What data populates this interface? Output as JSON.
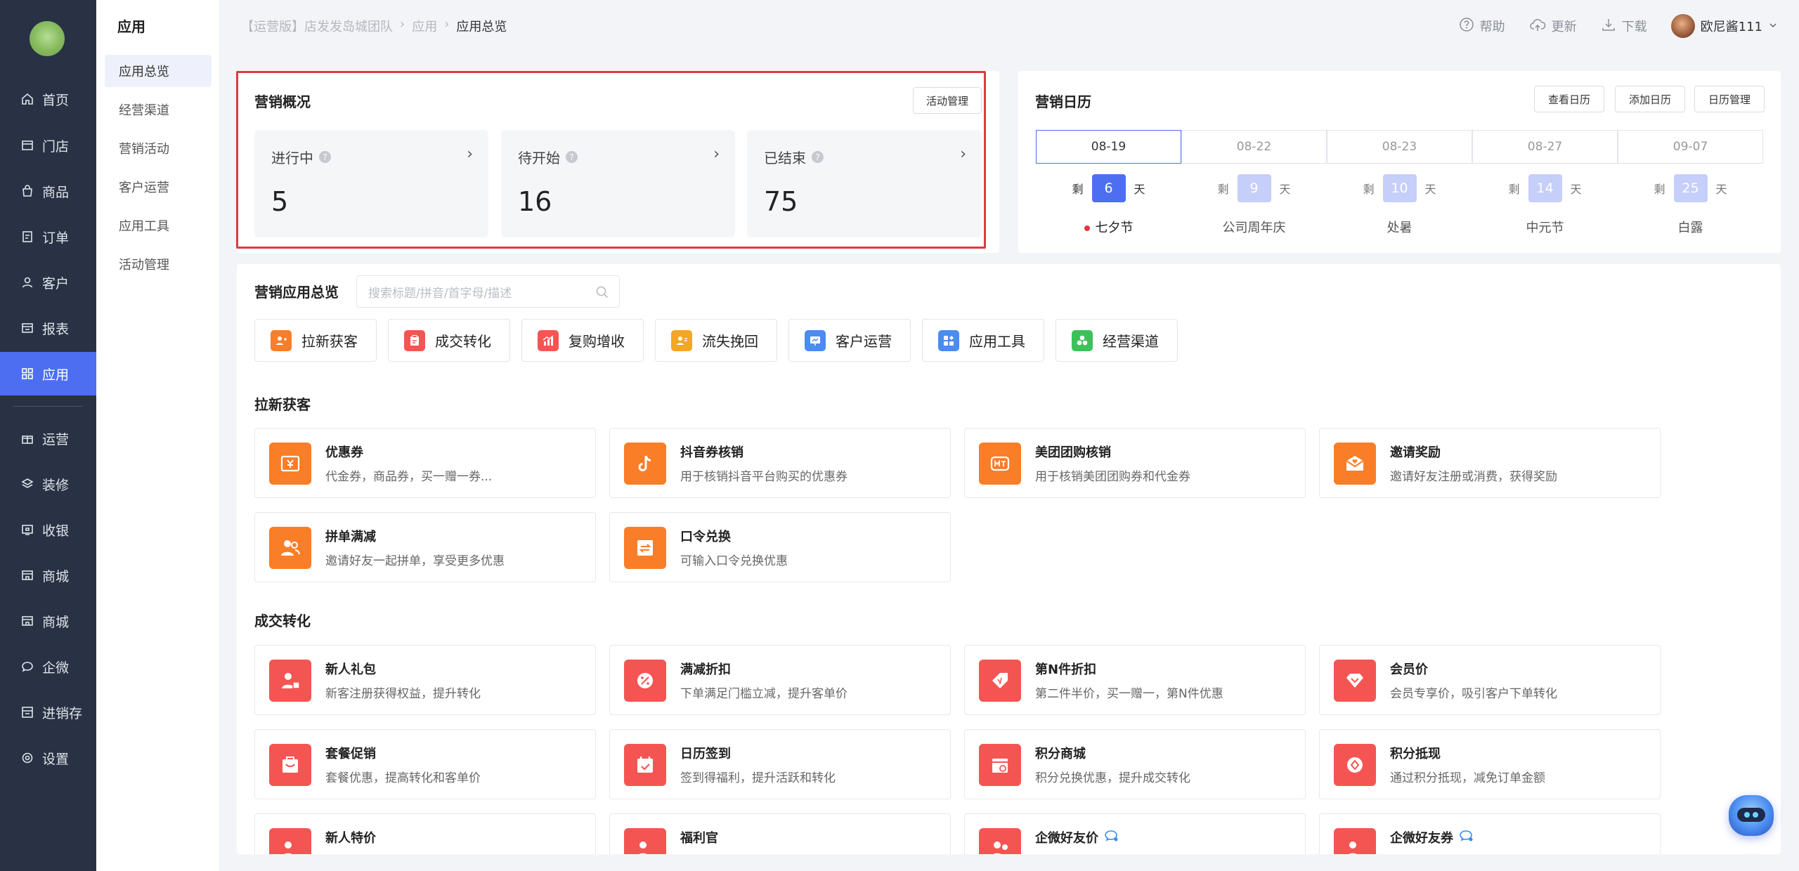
{
  "nav": {
    "items": [
      {
        "label": "首页",
        "icon": "home-icon"
      },
      {
        "label": "门店",
        "icon": "store-icon"
      },
      {
        "label": "商品",
        "icon": "bag-icon"
      },
      {
        "label": "订单",
        "icon": "order-icon"
      },
      {
        "label": "客户",
        "icon": "user-icon"
      },
      {
        "label": "报表",
        "icon": "report-icon"
      },
      {
        "label": "应用",
        "icon": "grid-icon"
      },
      {
        "label": "运营",
        "icon": "gift-icon"
      },
      {
        "label": "装修",
        "icon": "layers-icon"
      },
      {
        "label": "收银",
        "icon": "cashier-icon"
      },
      {
        "label": "商城",
        "icon": "shop-icon"
      },
      {
        "label": "商城",
        "icon": "shop-icon"
      },
      {
        "label": "企微",
        "icon": "chat-icon"
      },
      {
        "label": "进销存",
        "icon": "inventory-icon"
      },
      {
        "label": "设置",
        "icon": "gear-icon"
      }
    ],
    "active": "应用"
  },
  "subnav": {
    "title": "应用",
    "items": [
      "应用总览",
      "经营渠道",
      "营销活动",
      "客户运营",
      "应用工具",
      "活动管理"
    ]
  },
  "header": {
    "breadcrumb": [
      "【运营版】店发发岛城团队",
      "应用",
      "应用总览"
    ],
    "help": "帮助",
    "update": "更新",
    "download": "下载",
    "username": "欧尼酱111"
  },
  "overview": {
    "title": "营销概况",
    "manage_btn": "活动管理",
    "stats": [
      {
        "label": "进行中",
        "value": "5"
      },
      {
        "label": "待开始",
        "value": "16"
      },
      {
        "label": "已结束",
        "value": "75"
      }
    ]
  },
  "calendar": {
    "title": "营销日历",
    "buttons": [
      "查看日历",
      "添加日历",
      "日历管理"
    ],
    "remain_prefix": "剩",
    "remain_suffix": "天",
    "days": [
      {
        "date": "08-19",
        "remain": "6",
        "festival": "七夕节"
      },
      {
        "date": "08-22",
        "remain": "9",
        "festival": "公司周年庆"
      },
      {
        "date": "08-23",
        "remain": "10",
        "festival": "处暑"
      },
      {
        "date": "08-27",
        "remain": "14",
        "festival": "中元节"
      },
      {
        "date": "09-07",
        "remain": "25",
        "festival": "白露"
      }
    ]
  },
  "apps": {
    "title": "营销应用总览",
    "search_placeholder": "搜索标题/拼音/首字母/描述",
    "categories": [
      {
        "label": "拉新获客",
        "color": "#fa7d28"
      },
      {
        "label": "成交转化",
        "color": "#f45553"
      },
      {
        "label": "复购增收",
        "color": "#f45553"
      },
      {
        "label": "流失挽回",
        "color": "#f5a623"
      },
      {
        "label": "客户运营",
        "color": "#4a8cf0"
      },
      {
        "label": "应用工具",
        "color": "#4a8cf0"
      },
      {
        "label": "经营渠道",
        "color": "#3cc25a"
      }
    ],
    "sections": [
      {
        "title": "拉新获客",
        "items": [
          {
            "name": "优惠券",
            "desc": "代金券，商品券，买一赠一券...",
            "icon": "coupon-icon"
          },
          {
            "name": "抖音券核销",
            "desc": "用于核销抖音平台购买的优惠券",
            "icon": "douyin-icon"
          },
          {
            "name": "美团团购核销",
            "desc": "用于核销美团团购券和代金券",
            "icon": "meituan-icon"
          },
          {
            "name": "邀请奖励",
            "desc": "邀请好友注册或消费，获得奖励",
            "icon": "invite-icon"
          },
          {
            "name": "拼单满减",
            "desc": "邀请好友一起拼单，享受更多优惠",
            "icon": "group-icon"
          },
          {
            "name": "口令兑换",
            "desc": "可输入口令兑换优惠",
            "icon": "exchange-icon"
          }
        ]
      },
      {
        "title": "成交转化",
        "items": [
          {
            "name": "新人礼包",
            "desc": "新客注册获得权益，提升转化",
            "icon": "newcomer-icon"
          },
          {
            "name": "满减折扣",
            "desc": "下单满足门槛立减，提升客单价",
            "icon": "percent-icon"
          },
          {
            "name": "第N件折扣",
            "desc": "第二件半价，买一赠一，第N件优惠",
            "icon": "tag-icon"
          },
          {
            "name": "会员价",
            "desc": "会员专享价，吸引客户下单转化",
            "icon": "vip-icon"
          },
          {
            "name": "套餐促销",
            "desc": "套餐优惠，提高转化和客单价",
            "icon": "package-icon"
          },
          {
            "name": "日历签到",
            "desc": "签到得福利，提升活跃和转化",
            "icon": "calendar-check-icon"
          },
          {
            "name": "积分商城",
            "desc": "积分兑换优惠，提升成交转化",
            "icon": "points-shop-icon"
          },
          {
            "name": "积分抵现",
            "desc": "通过积分抵现，减免订单金额",
            "icon": "points-cash-icon"
          },
          {
            "name": "新人特价",
            "desc": "",
            "icon": "newcomer-price-icon"
          },
          {
            "name": "福利官",
            "desc": "",
            "icon": "welfare-icon"
          },
          {
            "name": "企微好友价",
            "desc": "",
            "icon": "wecom-price-icon"
          },
          {
            "name": "企微好友券",
            "desc": "",
            "icon": "wecom-coupon-icon"
          }
        ]
      }
    ]
  }
}
